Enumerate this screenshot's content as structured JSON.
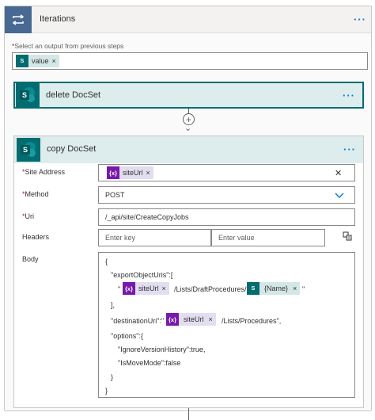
{
  "loop": {
    "title": "Iterations",
    "select_label": "Select an output from previous steps",
    "select_required": "*",
    "token": {
      "icon": "S",
      "label": "value",
      "remove": "×"
    }
  },
  "delete_action": {
    "title": "delete DocSet",
    "menu": "···"
  },
  "copy_action": {
    "title": "copy DocSet",
    "menu": "···",
    "fields": {
      "site_address": {
        "label": "Site Address",
        "required": "*",
        "token_icon": "{x}",
        "token_label": "siteUrl",
        "token_remove": "×",
        "clear": "✕"
      },
      "method": {
        "label": "Method",
        "required": "*",
        "value": "POST"
      },
      "uri": {
        "label": "Uri",
        "required": "*",
        "value": "/_api/site/CreateCopyJobs"
      },
      "headers": {
        "label": "Headers",
        "key_placeholder": "Enter key",
        "value_placeholder": "Enter value"
      },
      "body": {
        "label": "Body"
      }
    },
    "body_lines": {
      "l1": "{",
      "l2": "\"exportObjectUris\":[",
      "l3_prefix": "\"",
      "l3_token1": "siteUrl",
      "l3_mid": "/Lists/DraftProcedures/",
      "l3_token2": "{Name}",
      "l3_suffix": "\"",
      "l4": "],",
      "l5_prefix": "\"destinationUri\":\"",
      "l5_token": "siteUrl",
      "l5_suffix": "/Lists/Procedures\",",
      "l6": "\"options\":{",
      "l7": "\"IgnoreVersionHistory\":true,",
      "l8": "\"IsMoveMode\":false",
      "l9": "}",
      "l10": "}"
    },
    "token_icons": {
      "var": "{x}",
      "sp": "S"
    },
    "token_remove": "×"
  },
  "colors": {
    "loop_icon_bg": "#486991",
    "sharepoint": "#036c70",
    "variable_token": "#7719aa",
    "accent": "#0078d4"
  }
}
